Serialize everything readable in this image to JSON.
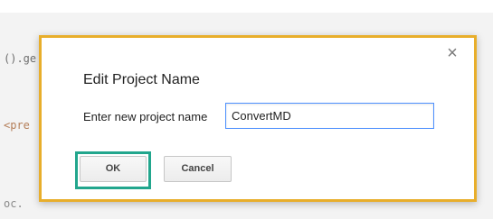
{
  "background": {
    "code_lines": [
      "().ge",
      "<pre",
      "oc."
    ]
  },
  "dialog": {
    "title": "Edit Project Name",
    "field_label": "Enter new project name",
    "input_value": "ConvertMD",
    "ok_label": "OK",
    "cancel_label": "Cancel",
    "close_glyph": "×"
  },
  "colors": {
    "dialog_border": "#e8ae2b",
    "ok_highlight": "#22a68d",
    "input_focus_border": "#4d90fe"
  }
}
